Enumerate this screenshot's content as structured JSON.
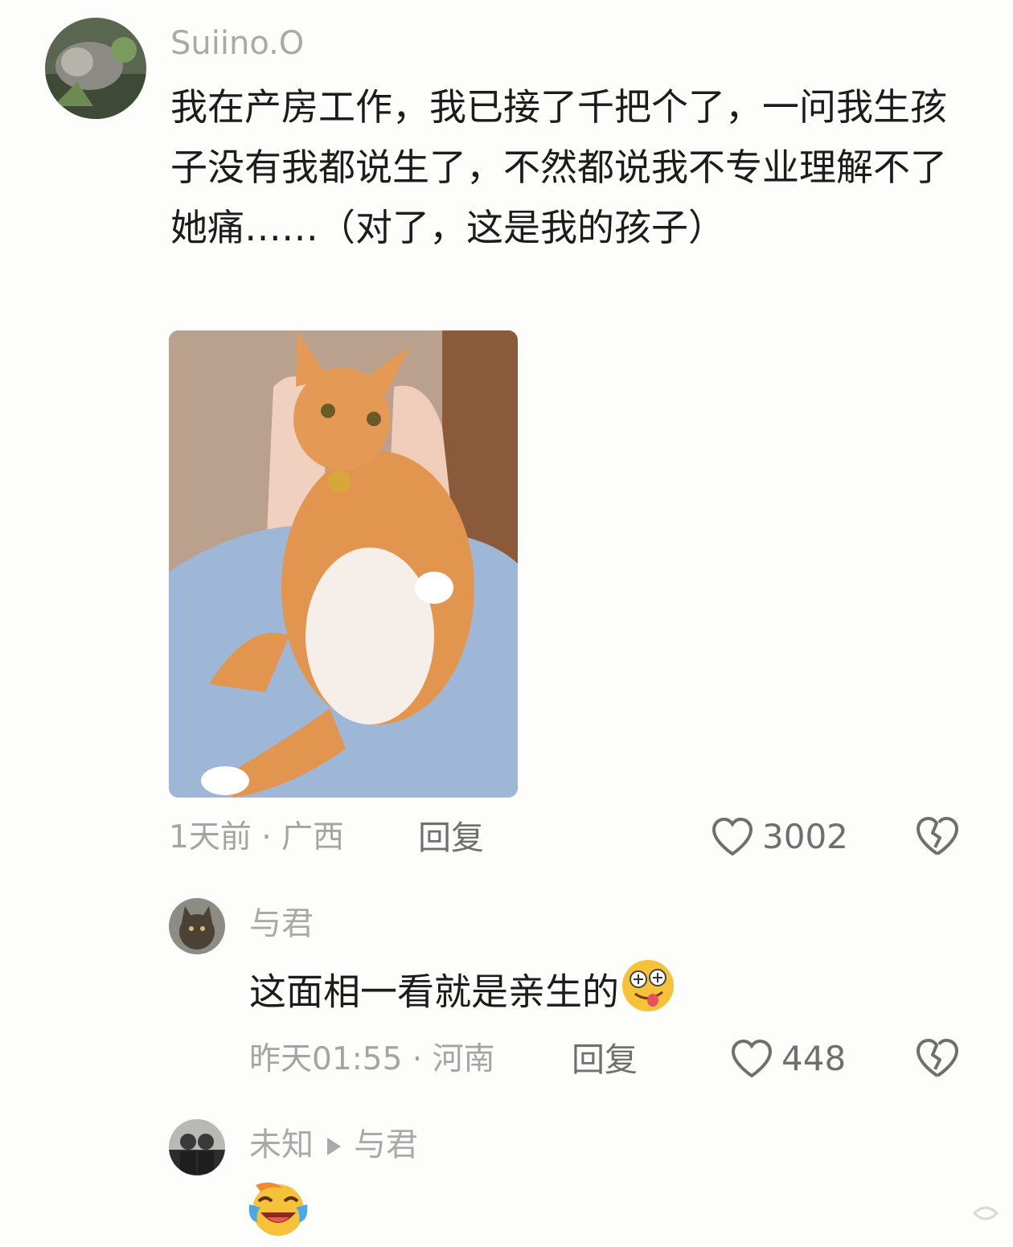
{
  "comment": {
    "username": "Suiino.O",
    "text": "我在产房工作，我已接了千把个了，一问我生孩子没有我都说生了，不然都说我不专业理解不了她痛……（对了，这是我的孩子）",
    "meta": "1天前 · 广西",
    "reply_label": "回复",
    "like_count": "3002",
    "image_subject": "orange-tabby-cat-photo"
  },
  "replies": [
    {
      "username": "与君",
      "text": "这面相一看就是亲生的",
      "emoji": "drooling-face-emoji",
      "meta": "昨天01:55 · 河南",
      "reply_label": "回复",
      "like_count": "448"
    },
    {
      "username": "未知",
      "reply_to": "与君",
      "emoji": "laughing-crying-face-emoji"
    }
  ],
  "colors": {
    "background": "#fdfdfc",
    "username": "#a9a9a9",
    "body_text": "#1c1c1c",
    "meta_text": "#a4a4a4",
    "action_text": "#6f6f6f"
  }
}
